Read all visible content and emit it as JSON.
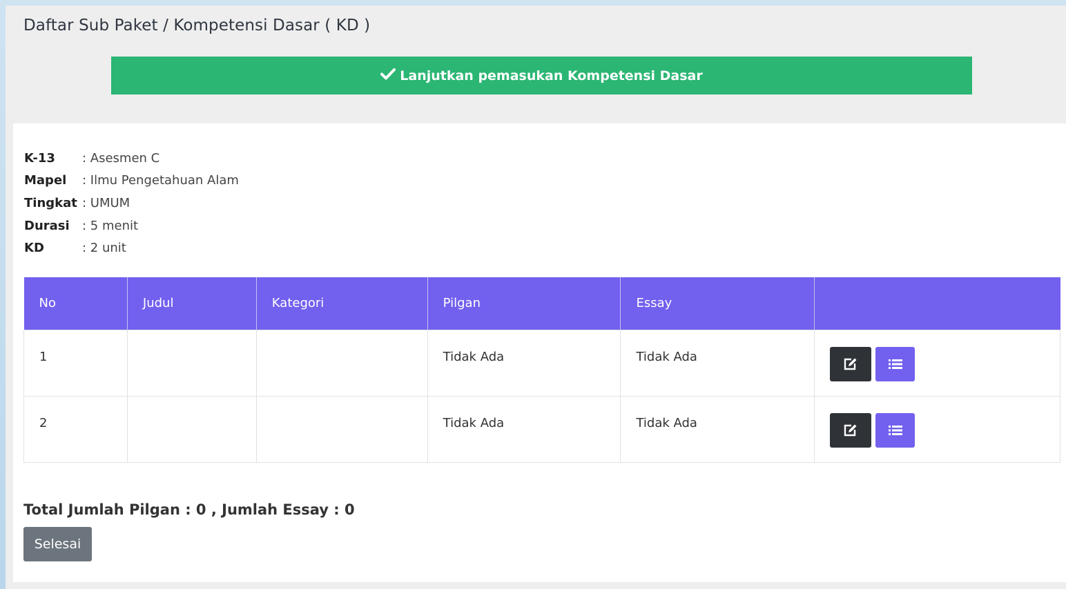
{
  "page": {
    "title": "Daftar Sub Paket / Kompetensi Dasar ( KD )",
    "banner_label": "Lanjutkan pemasukan Kompetensi Dasar"
  },
  "info": [
    {
      "key": "K-13",
      "value": ": Asesmen C"
    },
    {
      "key": "Mapel",
      "value": ": Ilmu Pengetahuan Alam"
    },
    {
      "key": "Tingkat",
      "value": ": UMUM"
    },
    {
      "key": "Durasi",
      "value": ": 5 menit"
    },
    {
      "key": "KD",
      "value": ": 2 unit"
    }
  ],
  "table": {
    "headers": [
      "No",
      "Judul",
      "Kategori",
      "Pilgan",
      "Essay",
      ""
    ],
    "rows": [
      {
        "no": "1",
        "judul": "",
        "kategori": "",
        "pilgan": "Tidak Ada",
        "essay": "Tidak Ada"
      },
      {
        "no": "2",
        "judul": "",
        "kategori": "",
        "pilgan": "Tidak Ada",
        "essay": "Tidak Ada"
      }
    ]
  },
  "footer": {
    "total_text": "Total Jumlah Pilgan : 0 , Jumlah Essay : 0",
    "finish_label": "Selesai"
  },
  "colors": {
    "banner": "#2bb673",
    "header": "#7260ee",
    "edit_button": "#2f3338",
    "finish_button": "#6c757d"
  },
  "icons": {
    "banner": "check-icon",
    "edit": "edit-icon",
    "list": "list-icon"
  }
}
